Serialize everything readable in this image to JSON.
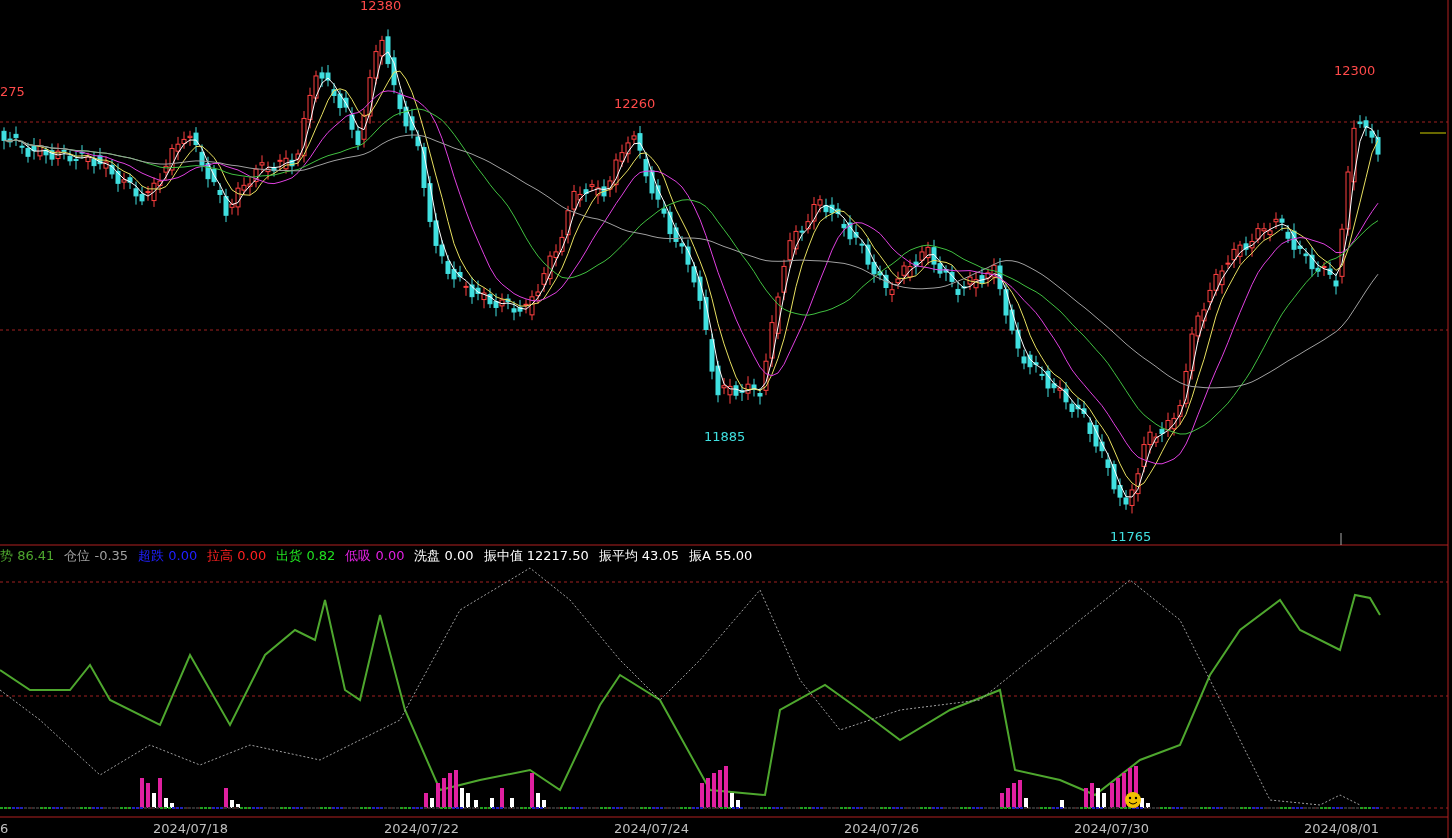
{
  "price_chart": {
    "extreme_labels": [
      {
        "text": "275",
        "kind": "high"
      },
      {
        "text": "12380",
        "kind": "high"
      },
      {
        "text": "12260",
        "kind": "high"
      },
      {
        "text": "11885",
        "kind": "low"
      },
      {
        "text": "11765",
        "kind": "low"
      },
      {
        "text": "12300",
        "kind": "high"
      }
    ]
  },
  "indicator_legend": [
    {
      "label": "势",
      "value": "86.41",
      "color": "#4ea72e"
    },
    {
      "label": "仓位",
      "value": "-0.35",
      "color": "#a0a0a0"
    },
    {
      "label": "超跌",
      "value": "0.00",
      "color": "#2020ff"
    },
    {
      "label": "拉高",
      "value": "0.00",
      "color": "#ff2020"
    },
    {
      "label": "出货",
      "value": "0.82",
      "color": "#20e020"
    },
    {
      "label": "低吸",
      "value": "0.00",
      "color": "#e020e0"
    },
    {
      "label": "洗盘",
      "value": "0.00",
      "color": "#ffffff"
    },
    {
      "label": "振中值",
      "value": "12217.50",
      "color": "#ffffff"
    },
    {
      "label": "振平均",
      "value": "43.05",
      "color": "#ffffff"
    },
    {
      "label": "振A",
      "value": "55.00",
      "color": "#ffffff"
    }
  ],
  "date_axis": [
    "6",
    "2024/07/18",
    "2024/07/22",
    "2024/07/24",
    "2024/07/26",
    "2024/07/30",
    "2024/08/01"
  ]
}
